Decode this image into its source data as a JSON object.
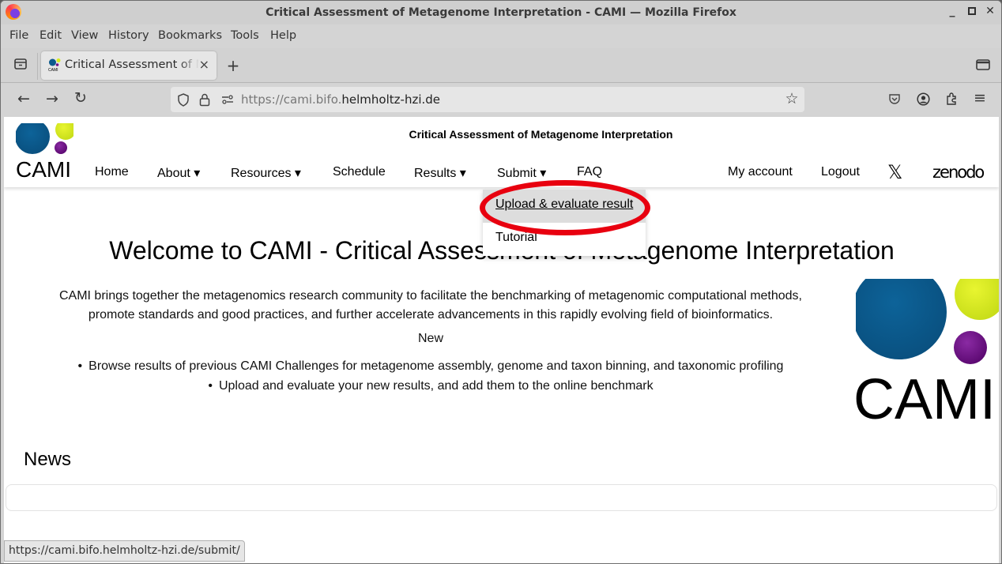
{
  "window": {
    "title": "Critical Assessment of Metagenome Interpretation - CAMI — Mozilla Firefox",
    "controls": {
      "minimize": "_",
      "maximize": "☐",
      "close": "✕"
    }
  },
  "menubar": {
    "items": [
      "File",
      "Edit",
      "View",
      "History",
      "Bookmarks",
      "Tools",
      "Help"
    ]
  },
  "tabs": [
    {
      "label": "Critical Assessment of Metagenome Interpretation - CAMI",
      "close": "×",
      "active": true
    }
  ],
  "new_tab": "+",
  "navbar": {
    "url_prefix": "https://cami.bifo.",
    "url_domain": "helmholtz-hzi.de",
    "icons": {
      "back": "←",
      "forward": "→",
      "reload": "↻",
      "shield": "shield-icon",
      "lock": "lock-icon",
      "permissions": "permissions-icon",
      "bookmark": "☆",
      "pocket": "pocket-icon",
      "account": "account-icon",
      "extensions": "extensions-icon",
      "menu": "≡"
    }
  },
  "site": {
    "title": "Critical Assessment of Metagenome Interpretation",
    "logo_text": "CAMI",
    "nav": [
      "Home",
      "About ▾",
      "Resources ▾",
      "Schedule",
      "Results ▾",
      "Submit ▾",
      "FAQ"
    ],
    "nav_right": [
      "My account",
      "Logout"
    ],
    "social": {
      "x": "𝕏",
      "zenodo": "zenodo"
    },
    "colors": {
      "blue": "#0b5a8c",
      "lime": "#d6ec1c",
      "purple": "#6e0f86",
      "annotation": "#e8000f"
    },
    "dropdown": {
      "parent": "Submit",
      "items": [
        "Upload & evaluate result",
        "Tutorial"
      ],
      "hovered_index": 0
    }
  },
  "main": {
    "heading": "Welcome to CAMI - Critical Assessment of Metagenome Interpretation",
    "intro": "CAMI brings together the metagenomics research community to facilitate the benchmarking of metagenomic computational methods, promote standards and good practices, and further accelerate advancements in this rapidly evolving field of bioinformatics.",
    "new_label": "New",
    "bullets": [
      "Browse results of previous CAMI Challenges for metagenome assembly, genome and taxon binning, and taxonomic profiling",
      "Upload and evaluate your new results, and add them to the online benchmark"
    ],
    "news_heading": "News"
  },
  "statusbar": {
    "url": "https://cami.bifo.helmholtz-hzi.de/submit/"
  }
}
